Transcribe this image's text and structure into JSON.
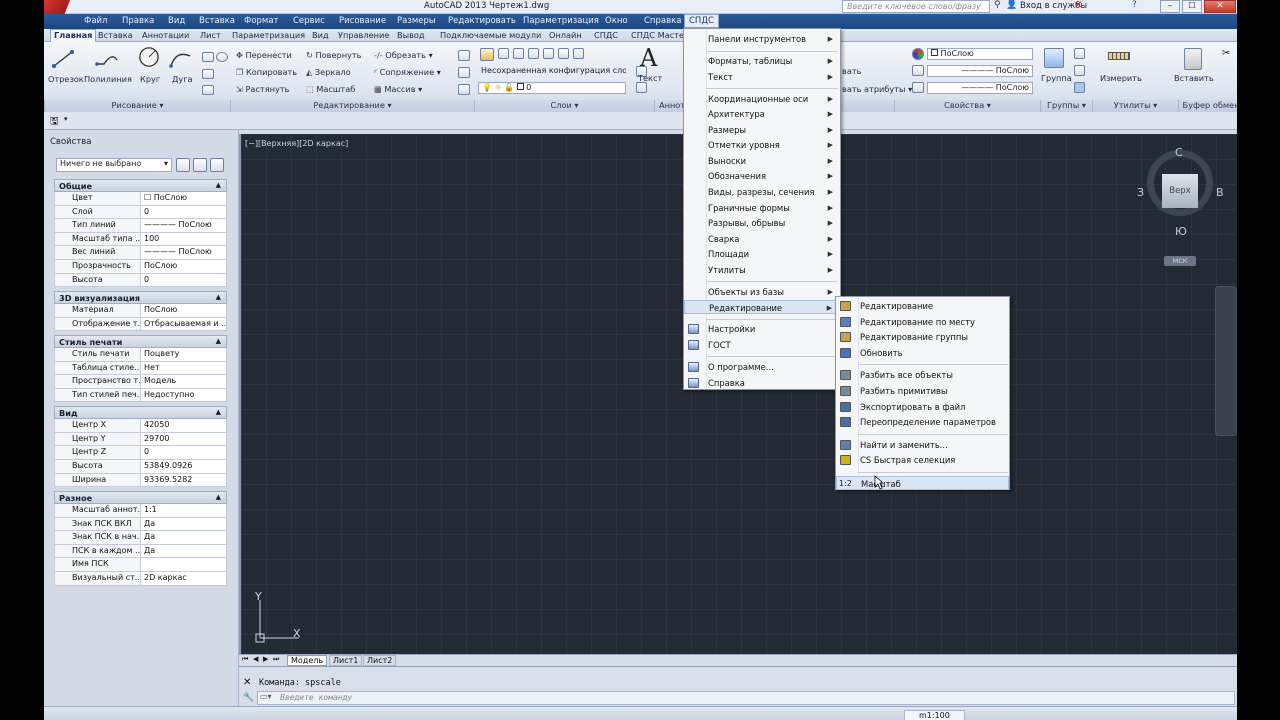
{
  "window": {
    "title": "AutoCAD 2013   Чертеж1.dwg",
    "search_placeholder": "Введите ключевое слово/фразу",
    "login": "Вход в службы"
  },
  "menubar": [
    "Файл",
    "Правка",
    "Вид",
    "Вставка",
    "Формат",
    "Сервис",
    "Рисование",
    "Размеры",
    "Редактировать",
    "Параметризация",
    "Окно",
    "Справка",
    "СПДС"
  ],
  "tabs": [
    "Главная",
    "Вставка",
    "Аннотации",
    "Лист",
    "Параметризация",
    "Вид",
    "Управление",
    "Вывод",
    "Подключаемые модули",
    "Онлайн",
    "СПДС",
    "СПДС Мастер"
  ],
  "ribbon": {
    "draw": {
      "line": "Отрезок",
      "polyline": "Полилиния",
      "circle": "Круг",
      "arc": "Дуга",
      "title": "Рисование ▾"
    },
    "modify": {
      "move": "Перенести",
      "rotate": "Повернуть",
      "trim": "Обрезать ▾",
      "copy": "Копировать",
      "mirror": "Зеркало",
      "fillet": "Сопряжение ▾",
      "stretch": "Растянуть",
      "scale": "Масштаб",
      "array": "Массив ▾",
      "title": "Редактирование ▾"
    },
    "layers": {
      "config": "Несохраненная конфигурация сло ▾",
      "layer": "0",
      "title": "Слои ▾"
    },
    "annot": {
      "text": "Текст",
      "title": "Аннот",
      "attr1": "вать",
      "attr2": "вать атрибуты ▾"
    },
    "properties": {
      "color": "ПоСлою",
      "linetype": "ПоСлою",
      "lineweight": "ПоСлою",
      "title": "Свойства ▾"
    },
    "groups": {
      "group": "Группа",
      "title": "Группы ▾"
    },
    "utils": {
      "measure": "Измерить",
      "title": "Утилиты ▾"
    },
    "clipboard": {
      "paste": "Вставить",
      "title": "Буфер обмена"
    }
  },
  "props": {
    "title": "Свойства",
    "selection": "Ничего не выбрано",
    "sections": [
      {
        "name": "Общие",
        "rows": [
          [
            "Цвет",
            "☐ ПоСлою"
          ],
          [
            "Слой",
            "0"
          ],
          [
            "Тип линий",
            "———— ПоСлою"
          ],
          [
            "Масштаб типа ...",
            "100"
          ],
          [
            "Вес линий",
            "———— ПоСлою"
          ],
          [
            "Прозрачность",
            "ПоСлою"
          ],
          [
            "Высота",
            "0"
          ]
        ]
      },
      {
        "name": "3D визуализация",
        "rows": [
          [
            "Материал",
            "ПоСлою"
          ],
          [
            "Отображение т...",
            "Отбрасываемая и ..."
          ]
        ]
      },
      {
        "name": "Стиль печати",
        "rows": [
          [
            "Стиль печати",
            "Поцвету"
          ],
          [
            "Таблица стиле...",
            "Нет"
          ],
          [
            "Пространство т...",
            "Модель"
          ],
          [
            "Тип стилей печ...",
            "Недоступно"
          ]
        ]
      },
      {
        "name": "Вид",
        "rows": [
          [
            "Центр X",
            "42050"
          ],
          [
            "Центр Y",
            "29700"
          ],
          [
            "Центр Z",
            "0"
          ],
          [
            "Высота",
            "53849.0926"
          ],
          [
            "Ширина",
            "93369.5282"
          ]
        ]
      },
      {
        "name": "Разное",
        "rows": [
          [
            "Масштаб аннот...",
            "1:1"
          ],
          [
            "Знак ПСК ВКЛ",
            "Да"
          ],
          [
            "Знак ПСК в нач...",
            "Да"
          ],
          [
            "ПСК в каждом ...",
            "Да"
          ],
          [
            "Имя ПСК",
            ""
          ],
          [
            "Визуальный ст...",
            "2D каркас"
          ]
        ]
      }
    ]
  },
  "viewport": {
    "label": "[−][Верхняя][2D каркас]",
    "cube_top": "Верх",
    "n": "С",
    "s": "Ю",
    "w": "З",
    "e": "В",
    "wcs": "МСК",
    "axis_y": "Y",
    "axis_x": "X"
  },
  "layout_tabs": [
    "Модель",
    "Лист1",
    "Лист2"
  ],
  "command": {
    "history": "Команда:  spscale",
    "placeholder": "Введите команду"
  },
  "status": {
    "scale": "m1:100"
  },
  "spds_menu": [
    {
      "label": "Панели инструментов",
      "sub": true
    },
    {
      "sep": true
    },
    {
      "label": "Форматы, таблицы",
      "sub": true
    },
    {
      "label": "Текст",
      "sub": true
    },
    {
      "sep": true
    },
    {
      "label": "Координационные оси",
      "sub": true
    },
    {
      "label": "Архитектура",
      "sub": true
    },
    {
      "label": "Размеры",
      "sub": true
    },
    {
      "label": "Отметки уровня",
      "sub": true
    },
    {
      "label": "Выноски",
      "sub": true
    },
    {
      "label": "Обозначения",
      "sub": true
    },
    {
      "label": "Виды, разрезы, сечения",
      "sub": true
    },
    {
      "label": "Граничные формы",
      "sub": true
    },
    {
      "label": "Разрывы, обрывы",
      "sub": true
    },
    {
      "label": "Сварка",
      "sub": true
    },
    {
      "label": "Площади",
      "sub": true
    },
    {
      "label": "Утилиты",
      "sub": true
    },
    {
      "sep": true
    },
    {
      "label": "Объекты из базы",
      "sub": true
    },
    {
      "label": "Редактирование",
      "sub": true,
      "hl": true
    },
    {
      "sep": true
    },
    {
      "label": "Настройки",
      "sub": false,
      "icon": true
    },
    {
      "label": "ГОСТ",
      "sub": false,
      "icon": true
    },
    {
      "sep": true
    },
    {
      "label": "О программе...",
      "sub": false,
      "icon": true
    },
    {
      "label": "Справка",
      "sub": false,
      "icon": true
    }
  ],
  "edit_submenu": [
    {
      "label": "Редактирование",
      "icon": "#c9a34a"
    },
    {
      "label": "Редактирование по месту",
      "icon": "#5a7fc0"
    },
    {
      "label": "Редактирование группы",
      "icon": "#c9a34a"
    },
    {
      "label": "Обновить",
      "icon": "#4a72b8"
    },
    {
      "sep": true
    },
    {
      "label": "Разбить все объекты",
      "icon": "#7a8aa0"
    },
    {
      "label": "Разбить примитивы",
      "icon": "#7a8aa0"
    },
    {
      "label": "Экспортировать в файл",
      "icon": "#4a6fa5"
    },
    {
      "label": "Переопределение параметров",
      "icon": "#4a6fa5"
    },
    {
      "sep": true
    },
    {
      "label": "Найти и заменить...",
      "icon": "#6080b0"
    },
    {
      "label": "CS Быстрая селекция",
      "icon": "#d0b020"
    },
    {
      "sep": true
    },
    {
      "label": "Масштаб",
      "icon": "",
      "prefix": "1:2",
      "hl": true
    }
  ]
}
